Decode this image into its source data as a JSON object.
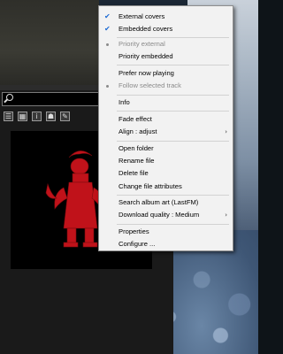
{
  "menu": {
    "external_covers": "External covers",
    "embedded_covers": "Embedded covers",
    "priority_external": "Priority external",
    "priority_embedded": "Priority embedded",
    "prefer_now_playing": "Prefer now playing",
    "follow_selected_track": "Follow selected track",
    "info": "Info",
    "fade_effect": "Fade effect",
    "align": "Align : adjust",
    "open_folder": "Open folder",
    "rename_file": "Rename file",
    "delete_file": "Delete file",
    "change_attributes": "Change file attributes",
    "search_album_art": "Search album art (LastFM)",
    "download_quality": "Download quality : Medium",
    "properties": "Properties",
    "configure": "Configure ..."
  },
  "toolbar": {
    "icons": [
      "list-icon",
      "grid-icon",
      "info-icon",
      "person-icon",
      "edit-icon"
    ],
    "glyphs": [
      "☰",
      "▦",
      "i",
      "☗",
      "✎"
    ]
  },
  "colors": {
    "menu_bg": "#f2f2f2",
    "check_accent": "#1b6ad4",
    "cover_art_red": "#c0121a",
    "panel_bg": "#1a1a1a"
  }
}
